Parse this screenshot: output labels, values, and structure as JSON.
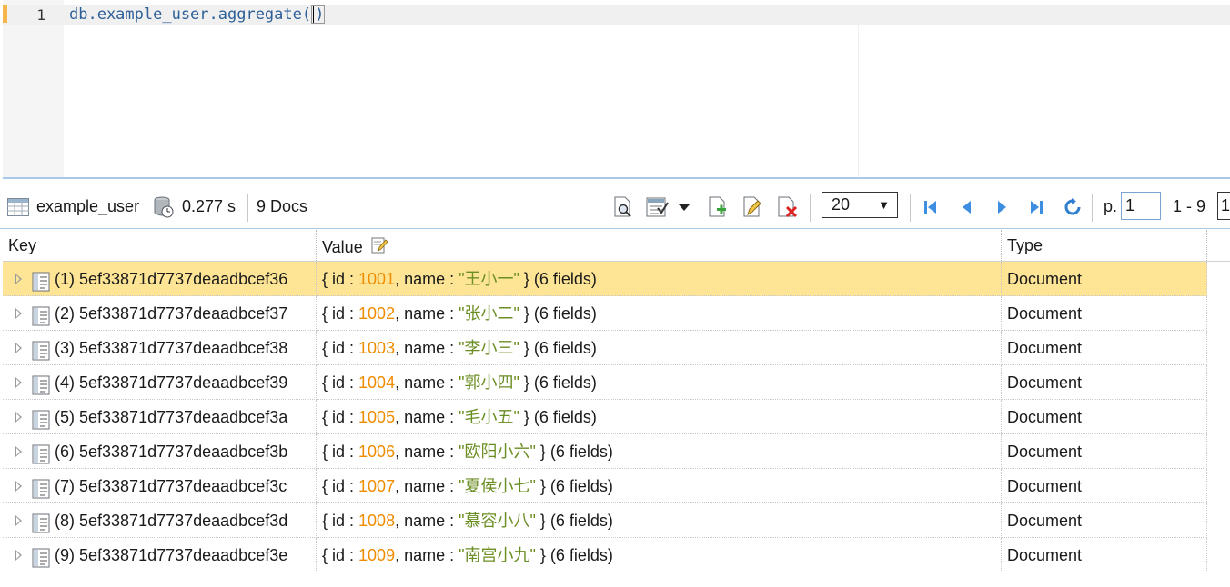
{
  "editor": {
    "line_number": "1",
    "code_before_cursor": "db.example_user.aggregate(",
    "code_after_cursor": ")"
  },
  "toolbar": {
    "collection": "example_user",
    "time": "0.277 s",
    "docs": "9 Docs",
    "page_size": "20",
    "page_label": "p.",
    "page_value": "1",
    "range": "1 - 9",
    "page_end_value": "1"
  },
  "table": {
    "columns": [
      "Key",
      "Value",
      "Type"
    ],
    "rows": [
      {
        "key": "(1) 5ef33871d7737deaadbcef36",
        "id_label": "{ id : ",
        "id": "1001",
        "name_label": ", name : ",
        "name": "\"王小一\"",
        "suffix": " } (6 fields)",
        "type": "Document"
      },
      {
        "key": "(2) 5ef33871d7737deaadbcef37",
        "id_label": "{ id : ",
        "id": "1002",
        "name_label": ", name : ",
        "name": "\"张小二\"",
        "suffix": " } (6 fields)",
        "type": "Document"
      },
      {
        "key": "(3) 5ef33871d7737deaadbcef38",
        "id_label": "{ id : ",
        "id": "1003",
        "name_label": ", name : ",
        "name": "\"李小三\"",
        "suffix": " } (6 fields)",
        "type": "Document"
      },
      {
        "key": "(4) 5ef33871d7737deaadbcef39",
        "id_label": "{ id : ",
        "id": "1004",
        "name_label": ", name : ",
        "name": "\"郭小四\"",
        "suffix": " } (6 fields)",
        "type": "Document"
      },
      {
        "key": "(5) 5ef33871d7737deaadbcef3a",
        "id_label": "{ id : ",
        "id": "1005",
        "name_label": ", name : ",
        "name": "\"毛小五\"",
        "suffix": " } (6 fields)",
        "type": "Document"
      },
      {
        "key": "(6) 5ef33871d7737deaadbcef3b",
        "id_label": "{ id : ",
        "id": "1006",
        "name_label": ", name : ",
        "name": "\"欧阳小六\"",
        "suffix": " } (6 fields)",
        "type": "Document"
      },
      {
        "key": "(7) 5ef33871d7737deaadbcef3c",
        "id_label": "{ id : ",
        "id": "1007",
        "name_label": ", name : ",
        "name": "\"夏侯小七\"",
        "suffix": " } (6 fields)",
        "type": "Document"
      },
      {
        "key": "(8) 5ef33871d7737deaadbcef3d",
        "id_label": "{ id : ",
        "id": "1008",
        "name_label": ", name : ",
        "name": "\"慕容小八\"",
        "suffix": " } (6 fields)",
        "type": "Document"
      },
      {
        "key": "(9) 5ef33871d7737deaadbcef3e",
        "id_label": "{ id : ",
        "id": "1009",
        "name_label": ", name : ",
        "name": "\"南宫小九\"",
        "suffix": " } (6 fields)",
        "type": "Document"
      }
    ],
    "selected_index": 0
  },
  "icons": {
    "collection": "table-grid-icon",
    "timer": "stopwatch-database-icon",
    "view_document": "magnify-document-icon",
    "view_mode": "view-mode-icon",
    "add_document": "add-document-icon",
    "edit_document": "edit-document-icon",
    "delete_document": "delete-document-icon",
    "first_page": "first-page-icon",
    "prev_page": "previous-page-icon",
    "next_page": "next-page-icon",
    "last_page": "last-page-icon",
    "refresh": "refresh-icon",
    "value_header": "edit-note-icon",
    "row_document": "document-tree-icon"
  },
  "colors": {
    "accent": "#a8c8e8",
    "selected_row": "#fde595",
    "number": "#f08c00",
    "string": "#6b8e23",
    "nav_blue": "#3d8ee0"
  }
}
